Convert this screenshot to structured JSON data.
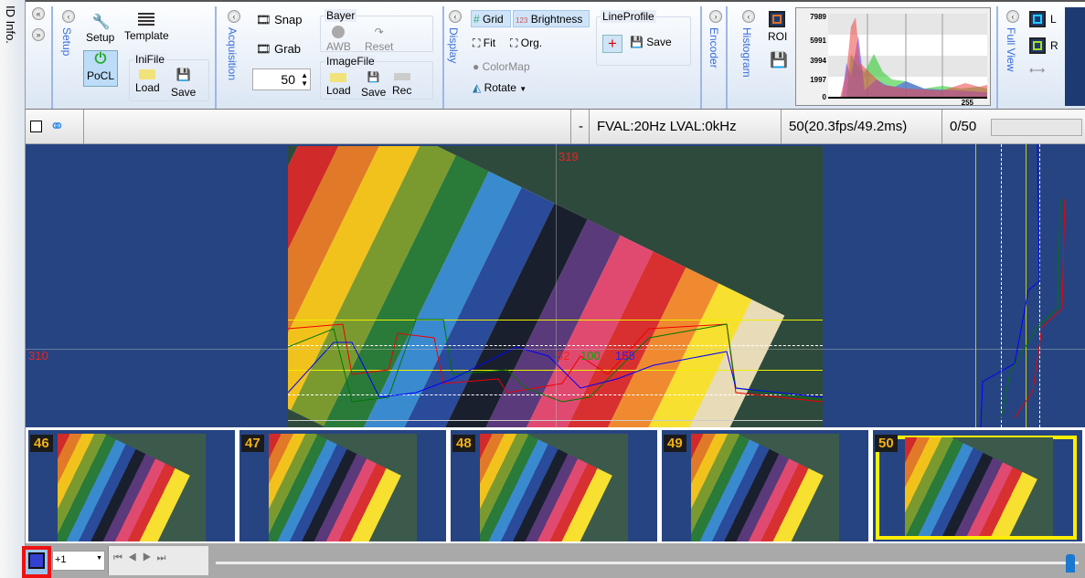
{
  "side_panel": {
    "label": "ID Info."
  },
  "ribbon": {
    "setup": {
      "group_label": "Setup",
      "setup": "Setup",
      "template": "Template",
      "pocl": "PoCL",
      "inifile": {
        "title": "IniFile",
        "load": "Load",
        "save": "Save"
      }
    },
    "acquisition": {
      "group_label": "Acquisition",
      "snap": "Snap",
      "grab": "Grab",
      "frame_count": "50",
      "bayer": {
        "title": "Bayer",
        "awb": "AWB",
        "reset": "Reset"
      },
      "imagefile": {
        "title": "ImageFile",
        "load": "Load",
        "save": "Save",
        "rec": "Rec"
      }
    },
    "display": {
      "group_label": "Display",
      "grid": "Grid",
      "brightness": "Brightness",
      "fit": "Fit",
      "org": "Org.",
      "colormap": "ColorMap",
      "rotate": "Rotate",
      "lineprofile": {
        "title": "LineProfile",
        "save": "Save"
      }
    },
    "encoder": {
      "group_label": "Encoder"
    },
    "histogram": {
      "group_label": "Histogram",
      "roi": "ROI",
      "y_ticks": [
        "7989",
        "5991",
        "3994",
        "1997",
        "0"
      ],
      "x_max": "255"
    },
    "fullview": {
      "group_label": "Full View",
      "left": "L",
      "right": "R"
    }
  },
  "status": {
    "dash": "-",
    "signal": "FVAL:20Hz  LVAL:0kHz",
    "frames": "50(20.3fps/49.2ms)",
    "counter": "0/50"
  },
  "view": {
    "cursor_x": "319",
    "cursor_y": "310",
    "r": "52",
    "g": "100",
    "b": "158"
  },
  "thumbnails": [
    {
      "num": "46"
    },
    {
      "num": "47"
    },
    {
      "num": "48"
    },
    {
      "num": "49"
    },
    {
      "num": "50",
      "selected": true
    }
  ],
  "playback": {
    "step": "+1"
  },
  "colors": {
    "view_bg": "#264481",
    "selected": "#ffee00",
    "accent": "#3a6fd8"
  }
}
